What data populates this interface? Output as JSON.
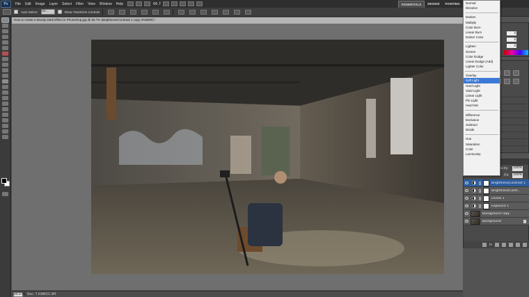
{
  "app": {
    "logo_text": "Ps",
    "menu": [
      "File",
      "Edit",
      "Image",
      "Layer",
      "Select",
      "Filter",
      "View",
      "Window",
      "Help"
    ],
    "zoom": "66.7",
    "workspaces": [
      "ESSENTIALS",
      "DESIGN",
      "PAINTING"
    ],
    "active_workspace": "ESSENTIALS"
  },
  "options_bar": {
    "auto_select_label": "Auto-Select:",
    "auto_select_value": "Gr...",
    "show_transform_label": "Show Transform Controls"
  },
  "document": {
    "tab_title": "How to create a Moody Dark Effect in Photoshop.jpg @ 66.7% (Brightness/Contrast 1 copy, RGB/8#) *",
    "zoom_field": "66.67%",
    "doc_size": "Doc: 7.03M/21.3M"
  },
  "color_panel": {
    "r": "0",
    "g": "0",
    "b": "0"
  },
  "blend_menu": {
    "groups": [
      [
        "Normal",
        "Dissolve"
      ],
      [
        "Darken",
        "Multiply",
        "Color Burn",
        "Linear Burn",
        "Darker Color"
      ],
      [
        "Lighten",
        "Screen",
        "Color Dodge",
        "Linear Dodge (Add)",
        "Lighter Color"
      ],
      [
        "Overlay",
        "Soft Light",
        "Hard Light",
        "Vivid Light",
        "Linear Light",
        "Pin Light",
        "Hard Mix"
      ],
      [
        "Difference",
        "Exclusion",
        "Subtract",
        "Divide"
      ],
      [
        "Hue",
        "Saturation",
        "Color",
        "Luminosity"
      ]
    ],
    "selected": "Soft Light"
  },
  "layers_panel": {
    "opacity_label": "Opacity:",
    "opacity": "100%",
    "fill_label": "Fill:",
    "fill": "100%",
    "footer_fx": "fx",
    "layers": [
      {
        "name": "Brightness/Contrast 1 ...",
        "type": "adjustment",
        "active": true,
        "italic": false
      },
      {
        "name": "Brightness/Contr...",
        "type": "adjustment",
        "active": false,
        "italic": false
      },
      {
        "name": "Levels 1",
        "type": "adjustment",
        "active": false,
        "italic": false
      },
      {
        "name": "Exposure 1",
        "type": "adjustment",
        "active": false,
        "italic": false
      },
      {
        "name": "Background copy",
        "type": "image",
        "active": false,
        "italic": false
      },
      {
        "name": "Background",
        "type": "image",
        "active": false,
        "italic": true,
        "locked": true
      }
    ]
  },
  "colors": {
    "selection_blue": "#3c79d6",
    "active_layer": "#2d5d9e",
    "panel_bg": "#4a4a4a"
  }
}
